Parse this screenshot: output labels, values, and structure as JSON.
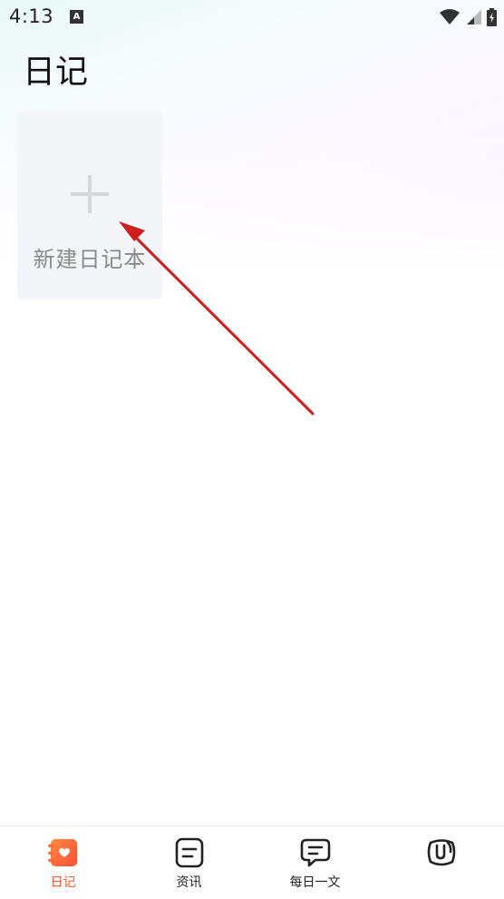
{
  "status_bar": {
    "time": "4:13",
    "app_indicator": "A"
  },
  "page": {
    "title": "日记"
  },
  "new_notebook": {
    "label": "新建日记本"
  },
  "bottom_nav": {
    "items": [
      {
        "label": "日记",
        "icon": "diary-heart-icon",
        "active": true
      },
      {
        "label": "资讯",
        "icon": "document-icon",
        "active": false
      },
      {
        "label": "每日一文",
        "icon": "chat-bubble-icon",
        "active": false
      },
      {
        "label": "",
        "icon": "profile-icon",
        "active": false
      }
    ]
  },
  "colors": {
    "accent": "#ff5a36",
    "annotation": "#cc1f1f",
    "card_bg": "#f4f5f8"
  }
}
